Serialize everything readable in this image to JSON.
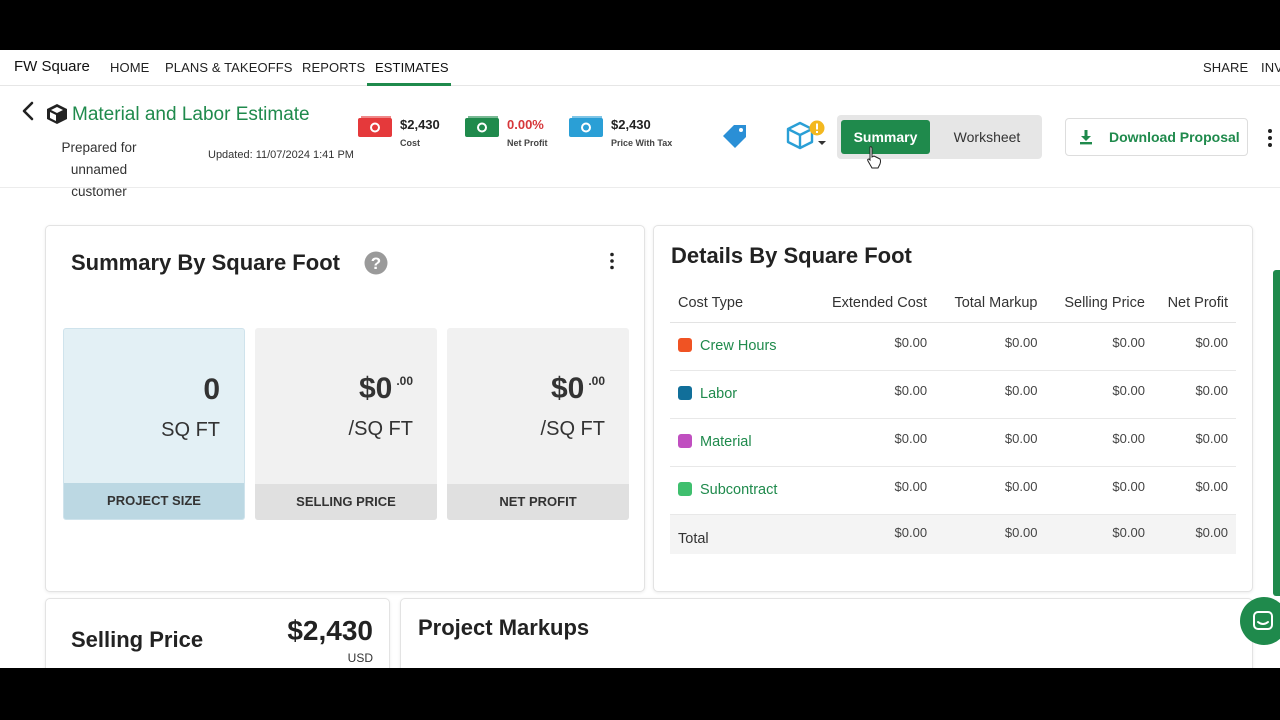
{
  "nav": {
    "brand": "FW Square",
    "links": [
      "HOME",
      "PLANS & TAKEOFFS",
      "REPORTS",
      "ESTIMATES",
      "SHARE",
      "INV"
    ]
  },
  "header": {
    "title": "Material and Labor Estimate",
    "prepared_for": "Prepared for",
    "customer": "unnamed customer",
    "updated": "Updated: 11/07/2024 1:41 PM",
    "stats": [
      {
        "value": "$2,430",
        "label": "Cost",
        "color": "#e5393b",
        "value_color": "#222"
      },
      {
        "value": "0.00%",
        "label": "Net Profit",
        "color": "#1f8a4c",
        "value_color": "#d6373a"
      },
      {
        "value": "$2,430",
        "label": "Price With Tax",
        "color": "#2a9fd6",
        "value_color": "#222"
      }
    ],
    "toggle": {
      "summary": "Summary",
      "worksheet": "Worksheet"
    },
    "download": "Download Proposal"
  },
  "summary_card": {
    "title": "Summary By Square Foot",
    "tiles": [
      {
        "value": "0",
        "unit": "SQ FT",
        "label": "PROJECT SIZE"
      },
      {
        "value": "$0",
        "sup": ".00",
        "unit": "/SQ FT",
        "label": "SELLING PRICE"
      },
      {
        "value": "$0",
        "sup": ".00",
        "unit": "/SQ FT",
        "label": "NET PROFIT"
      }
    ]
  },
  "details_card": {
    "title": "Details By Square Foot",
    "columns": [
      "Cost Type",
      "Extended Cost",
      "Total Markup",
      "Selling Price",
      "Net Profit"
    ],
    "rows": [
      {
        "type": "Crew Hours",
        "color": "#f05323",
        "extended": "$0.00",
        "markup": "$0.00",
        "selling": "$0.00",
        "profit": "$0.00"
      },
      {
        "type": "Labor",
        "color": "#116f9a",
        "extended": "$0.00",
        "markup": "$0.00",
        "selling": "$0.00",
        "profit": "$0.00"
      },
      {
        "type": "Material",
        "color": "#c04fc0",
        "extended": "$0.00",
        "markup": "$0.00",
        "selling": "$0.00",
        "profit": "$0.00"
      },
      {
        "type": "Subcontract",
        "color": "#3fbf6e",
        "extended": "$0.00",
        "markup": "$0.00",
        "selling": "$0.00",
        "profit": "$0.00"
      }
    ],
    "total": {
      "type": "Total",
      "extended": "$0.00",
      "markup": "$0.00",
      "selling": "$0.00",
      "profit": "$0.00"
    }
  },
  "selling_card": {
    "title": "Selling Price",
    "value": "$2,430",
    "currency": "USD"
  },
  "markups_card": {
    "title": "Project Markups"
  }
}
